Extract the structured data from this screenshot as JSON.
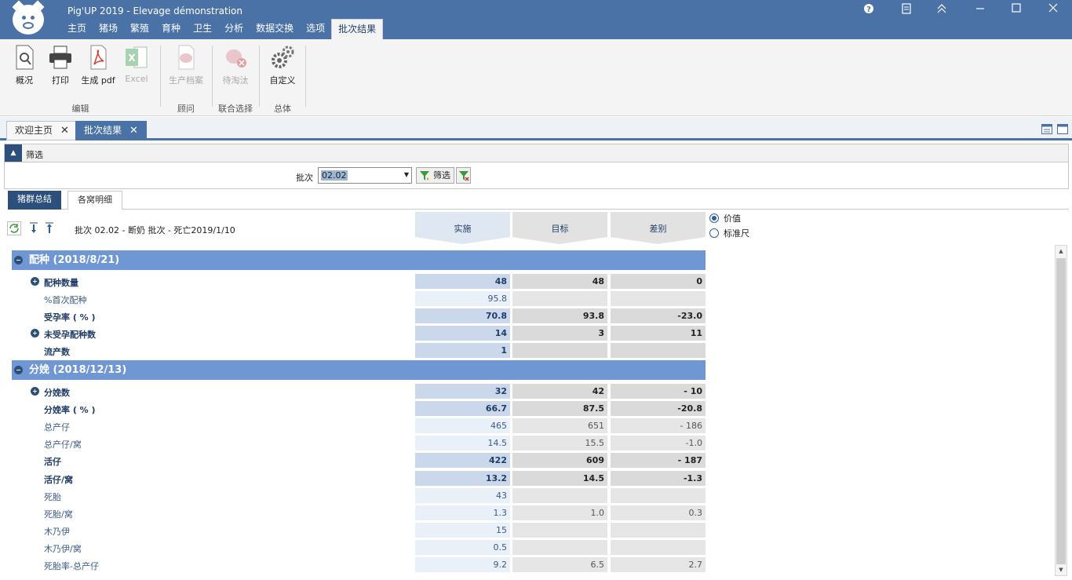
{
  "app": {
    "title": "Pig'UP 2019 - Elevage démonstration",
    "menu": [
      "主页",
      "猪场",
      "繁殖",
      "育种",
      "卫生",
      "分析",
      "数据交换",
      "选项",
      "批次结果"
    ],
    "active_menu": "批次结果",
    "window_buttons": [
      "help-icon",
      "notes-icon",
      "restore-ribbon-icon",
      "minimize-icon",
      "maximize-icon",
      "close-icon"
    ]
  },
  "ribbon": {
    "buttons": {
      "overview": "概况",
      "print": "打印",
      "pdf": "生成 pdf",
      "excel": "Excel",
      "production_file": "生产档案",
      "culling": "待淘汰",
      "custom": "自定义"
    },
    "groups": {
      "edit": "编辑",
      "advisor": "顾问",
      "joint_select": "联合选择",
      "general": "总体"
    }
  },
  "doc_tabs": [
    {
      "label": "欢迎主页"
    },
    {
      "label": "批次结果"
    }
  ],
  "filter": {
    "header": "筛选",
    "batch_label": "批次",
    "batch_value": "02.02",
    "filter_button": "筛选"
  },
  "sub_tabs": [
    "猪群总结",
    "各窝明细"
  ],
  "report": {
    "info": "批次 02.02 -  断奶 批次 - 死亡2019/1/10",
    "columns": [
      "实施",
      "目标",
      "差别"
    ],
    "radio": {
      "value": "价值",
      "standard": "标准尺",
      "selected": "价值"
    },
    "sections": [
      {
        "title": "配种 (2018/8/21)",
        "rows": [
          {
            "label": "配种数量",
            "expand": true,
            "bold": true,
            "actual": "48",
            "target": "48",
            "diff": "0"
          },
          {
            "label": "%首次配种",
            "expand": false,
            "bold": false,
            "actual": "95.8",
            "target": "",
            "diff": ""
          },
          {
            "label": "受孕率 ( % )",
            "expand": false,
            "bold": true,
            "actual": "70.8",
            "target": "93.8",
            "diff": "-23.0"
          },
          {
            "label": "未受孕配种数",
            "expand": true,
            "bold": true,
            "actual": "14",
            "target": "3",
            "diff": "11"
          },
          {
            "label": "流产数",
            "expand": false,
            "bold": true,
            "actual": "1",
            "target": "",
            "diff": ""
          }
        ]
      },
      {
        "title": "分娩 (2018/12/13)",
        "rows": [
          {
            "label": "分娩数",
            "expand": true,
            "bold": true,
            "actual": "32",
            "target": "42",
            "diff": "- 10"
          },
          {
            "label": "分娩率 ( % )",
            "expand": false,
            "bold": true,
            "actual": "66.7",
            "target": "87.5",
            "diff": "-20.8"
          },
          {
            "label": "总产仔",
            "expand": false,
            "bold": false,
            "actual": "465",
            "target": "651",
            "diff": "- 186"
          },
          {
            "label": "总产仔/窝",
            "expand": false,
            "bold": false,
            "actual": "14.5",
            "target": "15.5",
            "diff": "-1.0"
          },
          {
            "label": "活仔",
            "expand": false,
            "bold": true,
            "actual": "422",
            "target": "609",
            "diff": "- 187"
          },
          {
            "label": "活仔/窝",
            "expand": false,
            "bold": true,
            "actual": "13.2",
            "target": "14.5",
            "diff": "-1.3"
          },
          {
            "label": "死胎",
            "expand": false,
            "bold": false,
            "actual": "43",
            "target": "",
            "diff": ""
          },
          {
            "label": "死胎/窝",
            "expand": false,
            "bold": false,
            "actual": "1.3",
            "target": "1.0",
            "diff": "0.3"
          },
          {
            "label": "木乃伊",
            "expand": false,
            "bold": false,
            "actual": "15",
            "target": "",
            "diff": ""
          },
          {
            "label": "木乃伊/窝",
            "expand": false,
            "bold": false,
            "actual": "0.5",
            "target": "",
            "diff": ""
          },
          {
            "label": "死胎率-总产仔",
            "expand": false,
            "bold": false,
            "actual": "9.2",
            "target": "6.5",
            "diff": "2.7"
          }
        ]
      }
    ]
  },
  "colors": {
    "titlebar": "#4a72a6",
    "section_header": "#6f97d4",
    "active_tab": "#2d4f7c"
  }
}
